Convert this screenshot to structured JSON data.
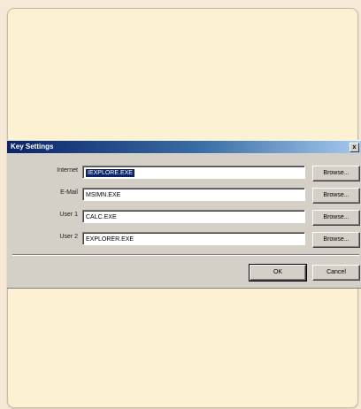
{
  "dialog": {
    "title": "Key Settings",
    "close_glyph": "x",
    "rows": [
      {
        "label": "Internet",
        "value": "IEXPLORE.EXE",
        "selected": true,
        "browse_label": "Browse..."
      },
      {
        "label": "E-Mail",
        "value": "MSIMN.EXE",
        "selected": false,
        "browse_label": "Browse..."
      },
      {
        "label": "User 1",
        "value": "CALC.EXE",
        "selected": false,
        "browse_label": "Browse..."
      },
      {
        "label": "User 2",
        "value": "EXPLORER.EXE",
        "selected": false,
        "browse_label": "Browse..."
      }
    ],
    "ok_label": "OK",
    "cancel_label": "Cancel"
  }
}
